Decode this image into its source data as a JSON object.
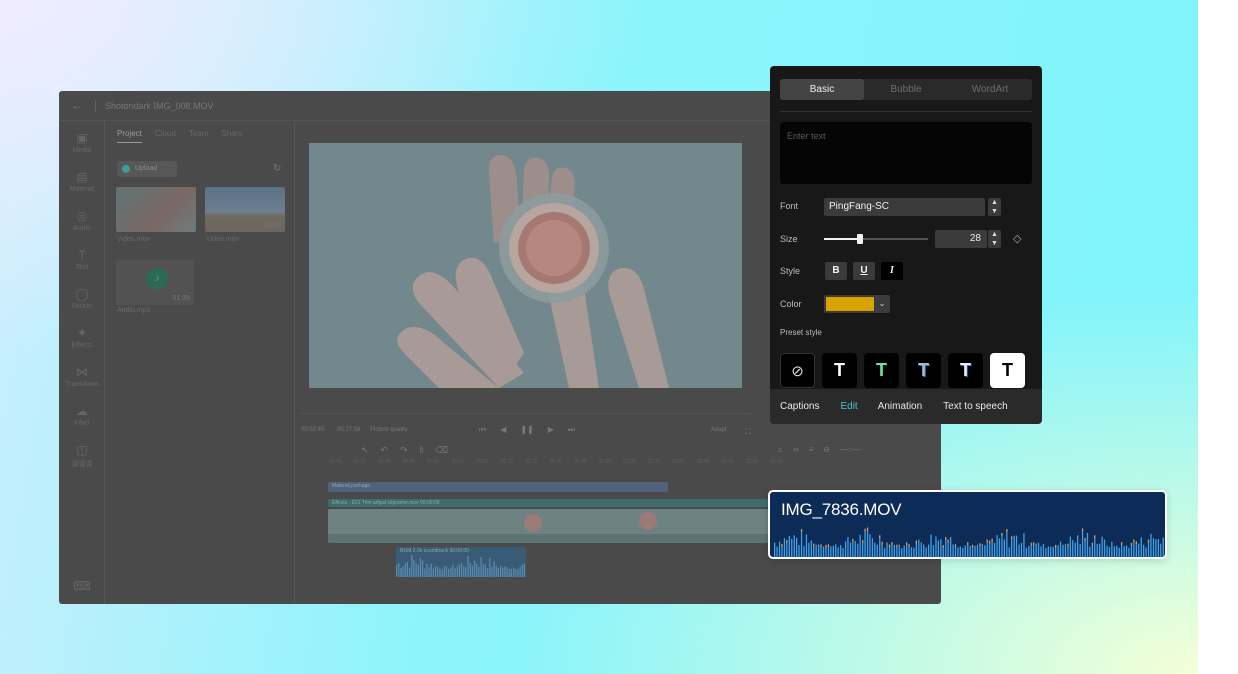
{
  "editor": {
    "title": "Shotondark IMG_008.MOV",
    "sidebar": [
      "Media",
      "Material",
      "Audio",
      "Text",
      "Sticker",
      "Effects",
      "Transitions",
      "Filter",
      "调调调"
    ],
    "panel_tabs": [
      "Project",
      "Cloud",
      "Team",
      "Share"
    ],
    "upload_label": "Upload",
    "media": [
      {
        "name": "Video.mov",
        "duration": "01:39"
      },
      {
        "name": "Video.mov",
        "duration": "01:39"
      },
      {
        "name": "Audio.mp3",
        "duration": "01:39"
      }
    ],
    "current_time": "00:02:45",
    "total_time": "00:27:58",
    "picture_quality": "Picture quality",
    "adapt": "Adapt",
    "ruler_ticks": [
      "00:00",
      "00:10",
      "00:20",
      "00:30",
      "00:40",
      "00:50",
      "01:00",
      "01:10",
      "01:20",
      "01:30",
      "01:40",
      "01:50",
      "02:00",
      "02:10",
      "02:20",
      "02:30",
      "02:40",
      "02:50",
      "03:00"
    ],
    "material_package_label": "Material package",
    "clip_labels": "Effects · E01  Trim  adjust  clipname.mov  00:00:00",
    "audio_clip_label": "BGM 2.0x  soundtrack  00:00:00"
  },
  "text_panel": {
    "tabs": [
      "Basic",
      "Bubble",
      "WordArt"
    ],
    "selected_tab": "Basic",
    "text_placeholder": "Enter text",
    "font_label": "Font",
    "font_value": "PingFang-SC",
    "size_label": "Size",
    "size_value": "28",
    "size_slider_fraction": 0.35,
    "style_label": "Style",
    "style_buttons": [
      "B",
      "U",
      "I"
    ],
    "color_label": "Color",
    "color_value": "#d9a400",
    "preset_label": "Preset style",
    "presets": [
      "none",
      "white-on-black",
      "green",
      "blue-outline",
      "dark-blue-outline",
      "black-on-white"
    ]
  },
  "bottom_tabs": [
    "Captions",
    "Edit",
    "Animation",
    "Text to speech"
  ],
  "active_bottom_tab": "Edit",
  "audio_card": {
    "filename": "IMG_7836.MOV"
  },
  "colors": {
    "accent": "#3fc6d6",
    "panel_bg": "#181818",
    "wave": "#3fa1e8",
    "wave_peak": "#e69a5a",
    "card_bg": "#0c2b56"
  }
}
